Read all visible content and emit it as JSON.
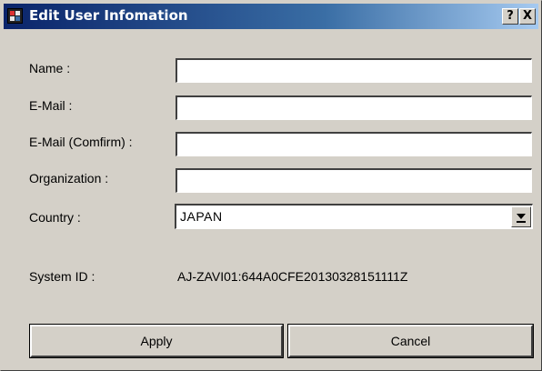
{
  "window": {
    "title": "Edit User Infomation",
    "help_label": "?",
    "close_label": "X",
    "colors": {
      "titlebar_start": "#0a246a",
      "titlebar_end": "#a6caf0",
      "face": "#d4d0c8"
    }
  },
  "form": {
    "name": {
      "label": "Name :",
      "value": ""
    },
    "email": {
      "label": "E-Mail :",
      "value": ""
    },
    "email_confirm": {
      "label": "E-Mail (Comfirm) :",
      "value": ""
    },
    "organization": {
      "label": "Organization :",
      "value": ""
    },
    "country": {
      "label": "Country :",
      "value": "JAPAN"
    },
    "system_id": {
      "label": "System ID :",
      "value": "AJ-ZAVI01:644A0CFE20130328151111Z"
    }
  },
  "buttons": {
    "apply": "Apply",
    "cancel": "Cancel"
  },
  "icons": {
    "app": "app-icon",
    "dropdown": "chevron-down-icon"
  }
}
